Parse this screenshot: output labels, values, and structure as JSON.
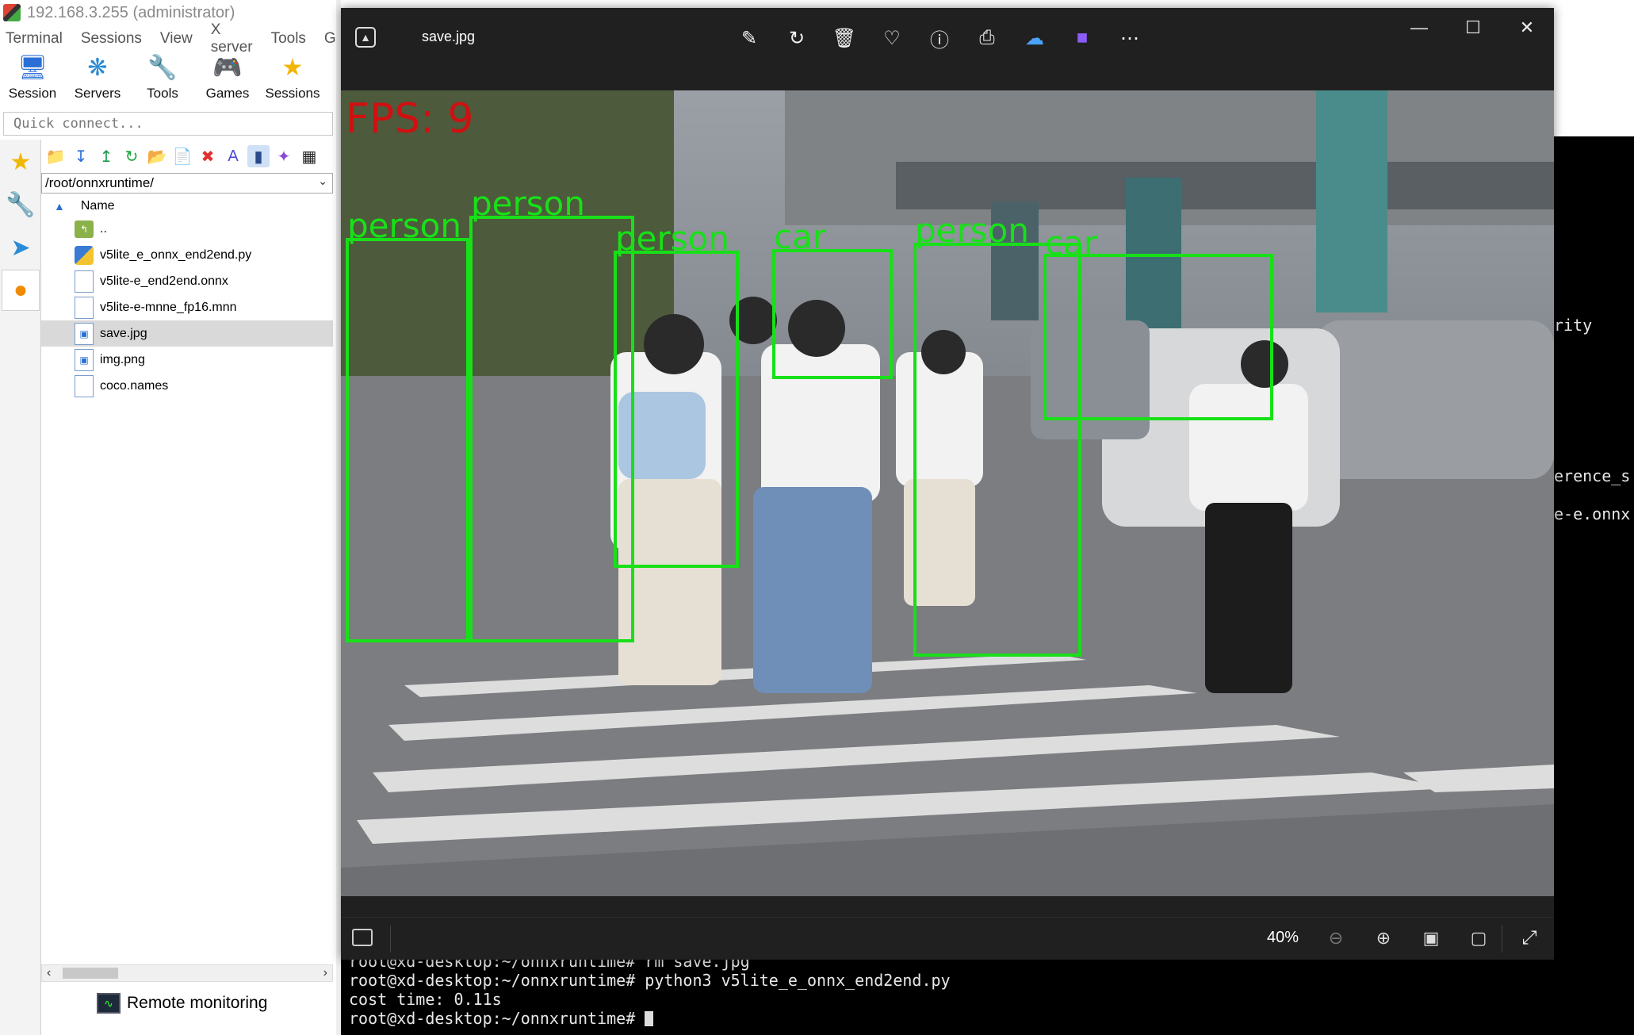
{
  "moba": {
    "title": "192.168.3.255 (administrator)",
    "menu": [
      "Terminal",
      "Sessions",
      "View",
      "X server",
      "Tools",
      "G"
    ],
    "toolbar": [
      {
        "label": "Session",
        "icon": "monitor-icon"
      },
      {
        "label": "Servers",
        "icon": "servers-icon"
      },
      {
        "label": "Tools",
        "icon": "tools-icon"
      },
      {
        "label": "Games",
        "icon": "gamepad-icon"
      },
      {
        "label": "Sessions",
        "icon": "star-icon"
      }
    ],
    "quick_connect_placeholder": "Quick connect...",
    "path": "/root/onnxruntime/",
    "column_name": "Name",
    "files": [
      {
        "name": "..",
        "type": "folder-up"
      },
      {
        "name": "v5lite_e_onnx_end2end.py",
        "type": "python"
      },
      {
        "name": "v5lite-e_end2end.onnx",
        "type": "file"
      },
      {
        "name": "v5lite-e-mnne_fp16.mnn",
        "type": "file"
      },
      {
        "name": "save.jpg",
        "type": "image"
      },
      {
        "name": "img.png",
        "type": "image"
      },
      {
        "name": "coco.names",
        "type": "file"
      }
    ],
    "selected_file": "save.jpg",
    "remote_monitoring": "Remote monitoring"
  },
  "photos": {
    "filename": "save.jpg",
    "zoom": "40%",
    "actions": [
      "edit-icon",
      "rotate-icon",
      "delete-icon",
      "favorite-icon",
      "info-icon",
      "print-icon",
      "onedrive-icon",
      "clipchamp-icon",
      "more-icon"
    ],
    "image": {
      "fps_text": "FPS: 9",
      "detections": [
        {
          "label": "person"
        },
        {
          "label": "person"
        },
        {
          "label": "person"
        },
        {
          "label": "car"
        },
        {
          "label": "person"
        },
        {
          "label": "car"
        }
      ]
    }
  },
  "terminal": {
    "lines": [
      "root@xd-desktop:~/onnxruntime# rm save.jpg",
      "root@xd-desktop:~/onnxruntime# python3 v5lite_e_onnx_end2end.py",
      "cost time: 0.11s",
      "root@xd-desktop:~/onnxruntime# "
    ],
    "right_fragments": [
      "rity",
      "erence_s",
      "e-e.onnx"
    ]
  },
  "colors": {
    "bbox": "#18e018",
    "fps": "#d01010",
    "viewer_bg": "#202020",
    "terminal_bg": "#000000"
  }
}
